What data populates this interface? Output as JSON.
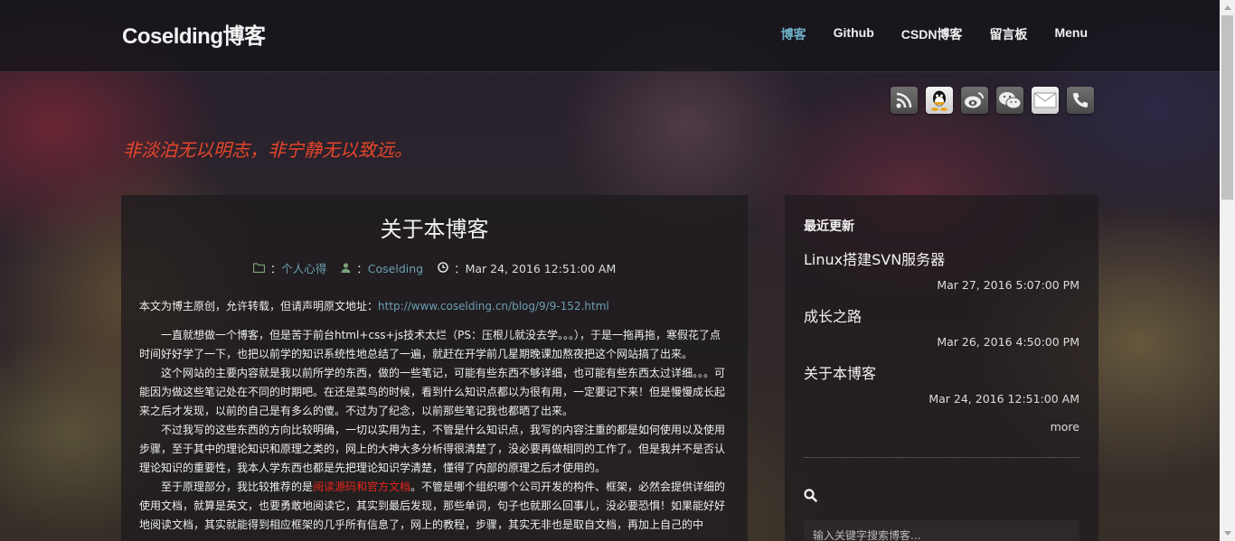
{
  "brand": "Coselding博客",
  "nav": [
    "博客",
    "Github",
    "CSDN博客",
    "留言板",
    "Menu"
  ],
  "social_icons": [
    "rss-icon",
    "qq-icon",
    "weibo-icon",
    "wechat-icon",
    "mail-icon",
    "phone-icon"
  ],
  "motto": "非淡泊无以明志，非宁静无以致远。",
  "article": {
    "title": "关于本博客",
    "category": "个人心得",
    "author": "Coselding",
    "date": "Mar 24, 2016 12:51:00 AM",
    "category_prefix": "：",
    "author_prefix": "：",
    "date_prefix": "：",
    "source_label": "本文为博主原创，允许转载，但请声明原文地址：",
    "source_url": "http://www.coselding.cn/blog/9/9-152.html",
    "p1": "一直就想做一个博客，但是苦于前台html+css+js技术太烂（PS：压根儿就没去学。。。），于是一拖再拖，寒假花了点时间好好学了一下，也把以前学的知识系统性地总结了一遍，就赶在开学前几星期晚课加熬夜把这个网站搞了出来。",
    "p2": "这个网站的主要内容就是我以前所学的东西，做的一些笔记，可能有些东西不够详细，也可能有些东西太过详细。。。可能因为做这些笔记处在不同的时期吧。在还是菜鸟的时候，看到什么知识点都以为很有用，一定要记下来！但是慢慢成长起来之后才发现，以前的自己是有多么的傻。不过为了纪念，以前那些笔记我也都晒了出来。",
    "p3": "不过我写的这些东西的方向比较明确，一切以实用为主，不管是什么知识点，我写的内容注重的都是如何使用以及使用步骤，至于其中的理论知识和原理之类的，网上的大神大多分析得很清楚了，没必要再做相同的工作了。但是我并不是否认理论知识的重要性，我本人学东西也都是先把理论知识学清楚，懂得了内部的原理之后才使用的。",
    "p4_a": "至于原理部分，我比较推荐的是",
    "p4_link": "阅读源码和官方文档",
    "p4_b": "。不管是哪个组织哪个公司开发的构件、框架，必然会提供详细的使用文档，就算是英文，也要勇敢地阅读它，其实到最后发现，那些单词，句子也就那么回事儿，没必要恐惧！如果能好好地阅读文档，其实就能得到相应框架的几乎所有信息了，网上的教程，步骤，其实无非也是取自文档，再加上自己的中"
  },
  "sidebar": {
    "title": "最近更新",
    "posts": [
      {
        "title": "Linux搭建SVN服务器",
        "date": "Mar 27, 2016 5:07:00 PM"
      },
      {
        "title": "成长之路",
        "date": "Mar 26, 2016 4:50:00 PM"
      },
      {
        "title": "关于本博客",
        "date": "Mar 24, 2016 12:51:00 AM"
      }
    ],
    "more": "more",
    "search_placeholder": "输入关键字搜索博客..."
  }
}
